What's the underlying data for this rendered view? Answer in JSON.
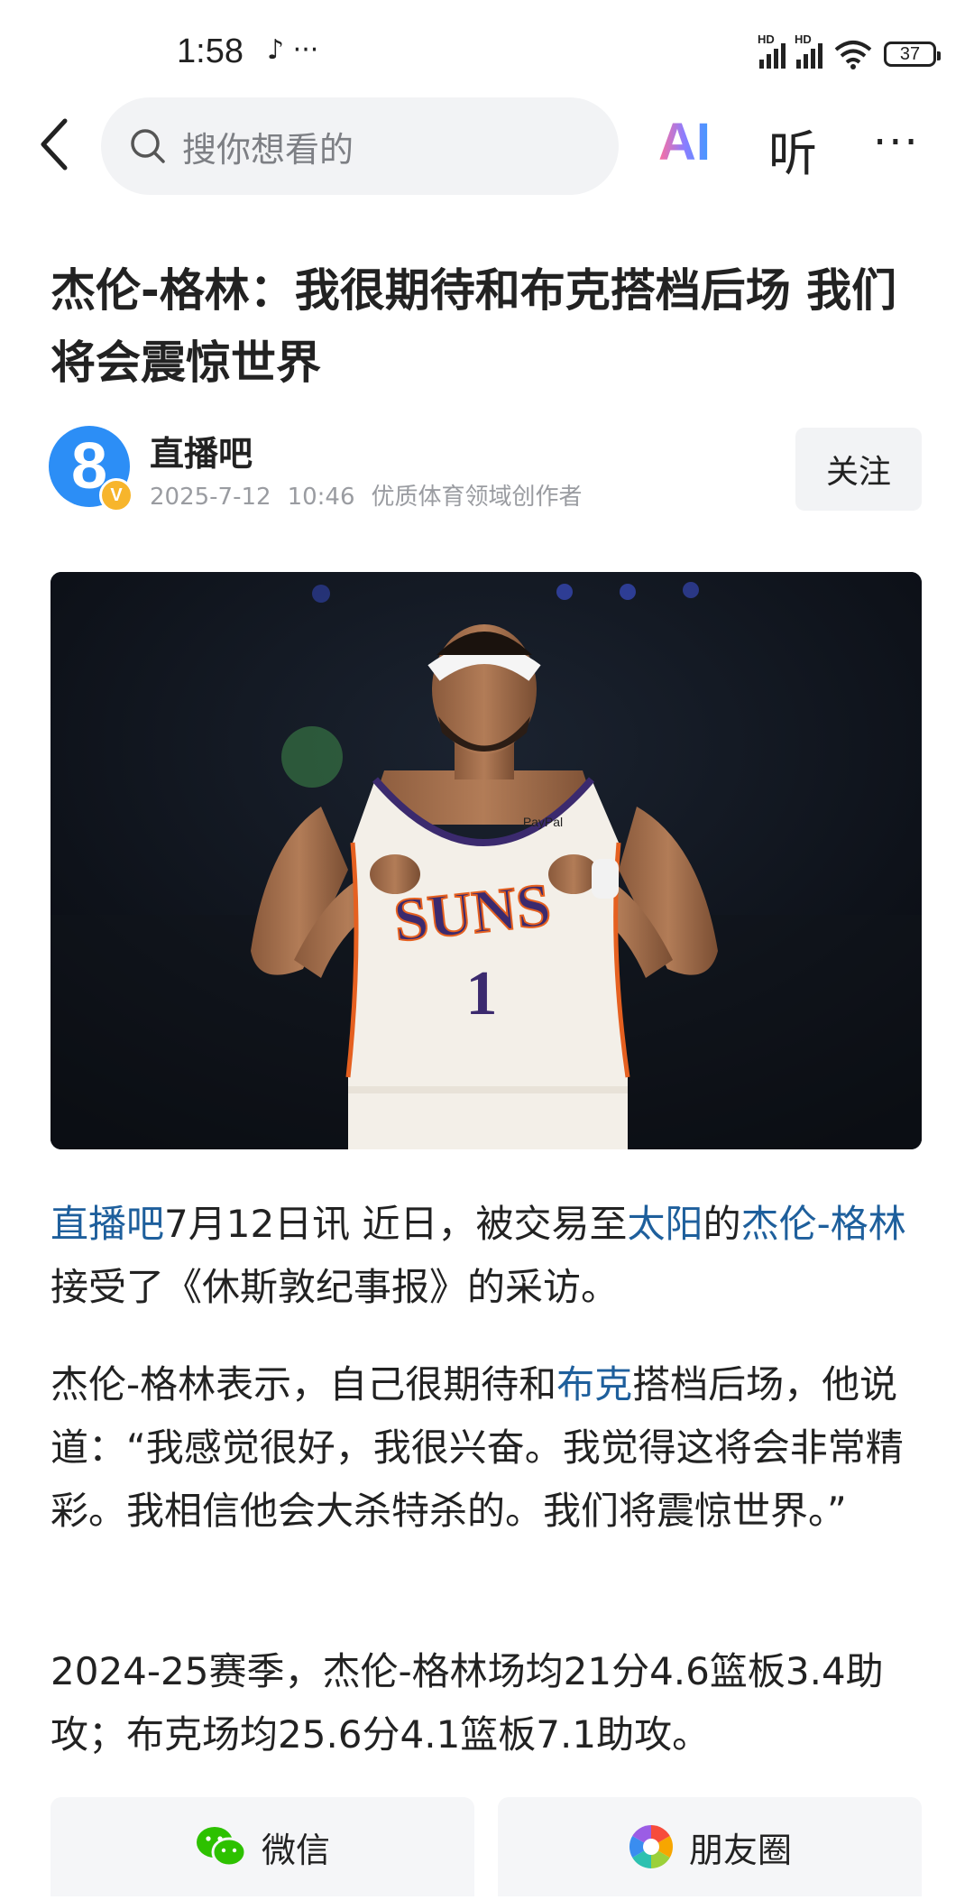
{
  "status_bar": {
    "time": "1:58",
    "app_icons": "♪ ···",
    "signal_1_label": "HD",
    "signal_2_label": "HD",
    "battery": "37"
  },
  "nav": {
    "search_placeholder": "搜你想看的",
    "ai_label": "AI",
    "listen_label": "听",
    "more_label": "···"
  },
  "article": {
    "title": "杰伦-格林：我很期待和布克搭档后场 我们将会震惊世界",
    "author": {
      "avatar_text": "8",
      "badge_text": "V",
      "name": "直播吧",
      "date": "2025-7-12",
      "time": "10:46",
      "tagline": "优质体育领域创作者"
    },
    "follow_label": "关注",
    "paragraphs": {
      "p1": {
        "source_link": "直播吧",
        "t1": "7月12日讯 近日，被交易至",
        "team_link": "太阳",
        "t2": "的",
        "player_link": "杰伦-格林",
        "t3": "接受了《休斯敦纪事报》的采访。"
      },
      "p2": {
        "t1": "杰伦-格林表示，自己很期待和",
        "player_link": "布克",
        "t2": "搭档后场，他说道：“我感觉很好，我很兴奋。我觉得这将会非常精彩。我相信他会大杀特杀的。我们将震惊世界。”"
      },
      "p3": {
        "t1": "2024-25赛季，杰伦-格林场均21分4.6篮板3.4助攻；布克场均25.6分4.1篮板7.1助攻。"
      }
    },
    "jersey_text": "SUNS",
    "jersey_number": "1",
    "jersey_sponsor": "PayPal"
  },
  "share": {
    "wechat_label": "微信",
    "moments_label": "朋友圈"
  },
  "colors": {
    "link": "#1e5f9c",
    "avatar": "#2c8ef6",
    "badge": "#f7b52c",
    "jersey_purple": "#3b2a6e",
    "jersey_orange": "#e56020"
  }
}
